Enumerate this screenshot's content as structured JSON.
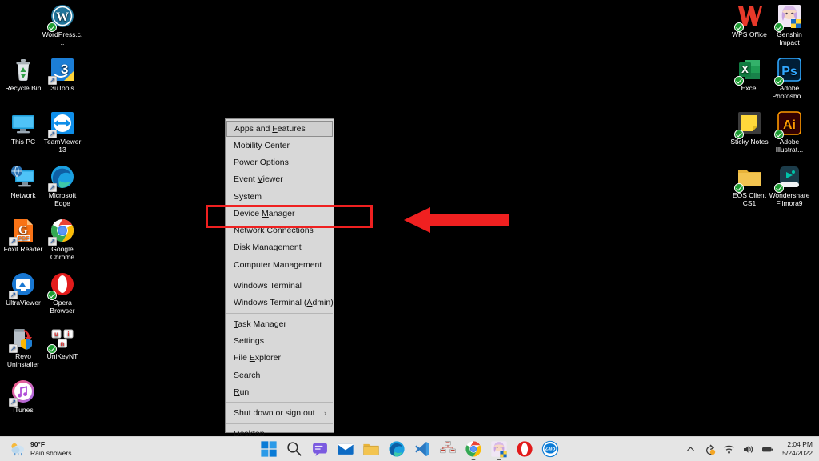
{
  "desktop": {
    "background_color": "#000000",
    "icons_left": [
      {
        "label": "WordPress.c...",
        "icon": "wordpress-icon",
        "col": 1,
        "row": 0,
        "badge": "check"
      },
      {
        "label": "Recycle Bin",
        "icon": "recycle-bin-icon",
        "col": 0,
        "row": 1,
        "badge": "none"
      },
      {
        "label": "3uTools",
        "icon": "3utools-icon",
        "col": 1,
        "row": 1,
        "badge": "shortcut"
      },
      {
        "label": "This PC",
        "icon": "this-pc-icon",
        "col": 0,
        "row": 2,
        "badge": "none"
      },
      {
        "label": "TeamViewer 13",
        "icon": "teamviewer-icon",
        "col": 1,
        "row": 2,
        "badge": "shortcut"
      },
      {
        "label": "Network",
        "icon": "network-icon",
        "col": 0,
        "row": 3,
        "badge": "none"
      },
      {
        "label": "Microsoft Edge",
        "icon": "edge-icon",
        "col": 1,
        "row": 3,
        "badge": "shortcut"
      },
      {
        "label": "Foxit Reader",
        "icon": "foxit-reader-icon",
        "col": 0,
        "row": 4,
        "badge": "shortcut"
      },
      {
        "label": "Google Chrome",
        "icon": "chrome-icon",
        "col": 1,
        "row": 4,
        "badge": "shortcut"
      },
      {
        "label": "UltraViewer",
        "icon": "ultraviewer-icon",
        "col": 0,
        "row": 5,
        "badge": "shortcut"
      },
      {
        "label": "Opera Browser",
        "icon": "opera-icon",
        "col": 1,
        "row": 5,
        "badge": "check"
      },
      {
        "label": "Revo Uninstaller",
        "icon": "revo-uninstaller-icon",
        "col": 0,
        "row": 6,
        "badge": "shortcut"
      },
      {
        "label": "UniKeyNT",
        "icon": "unikey-icon",
        "col": 1,
        "row": 6,
        "badge": "check"
      },
      {
        "label": "iTunes",
        "icon": "itunes-icon",
        "col": 0,
        "row": 7,
        "badge": "shortcut"
      }
    ],
    "icons_right": [
      {
        "label": "WPS Office",
        "icon": "wps-office-icon",
        "col": 0,
        "row": 0,
        "badge": "check"
      },
      {
        "label": "Genshin Impact",
        "icon": "genshin-impact-icon",
        "col": 1,
        "row": 0,
        "badge": "check"
      },
      {
        "label": "Excel",
        "icon": "excel-icon",
        "col": 0,
        "row": 1,
        "badge": "check"
      },
      {
        "label": "Adobe Photosho...",
        "icon": "photoshop-icon",
        "col": 1,
        "row": 1,
        "badge": "check"
      },
      {
        "label": "Sticky Notes",
        "icon": "sticky-notes-icon",
        "col": 0,
        "row": 2,
        "badge": "check"
      },
      {
        "label": "Adobe Illustrat...",
        "icon": "illustrator-icon",
        "col": 1,
        "row": 2,
        "badge": "check"
      },
      {
        "label": "EOS Client CS1",
        "icon": "folder-icon",
        "col": 0,
        "row": 3,
        "badge": "check"
      },
      {
        "label": "Wondershare Filmora9",
        "icon": "filmora-icon",
        "col": 1,
        "row": 3,
        "badge": "check"
      }
    ]
  },
  "context_menu": {
    "name": "win-x-power-user-menu",
    "items": [
      {
        "label": "Apps and Features",
        "accel": "F",
        "highlighted": true,
        "submenu": false,
        "separator_after": false
      },
      {
        "label": "Mobility Center",
        "accel": "B",
        "highlighted": false,
        "submenu": false,
        "separator_after": false
      },
      {
        "label": "Power Options",
        "accel": "O",
        "highlighted": false,
        "submenu": false,
        "separator_after": false
      },
      {
        "label": "Event Viewer",
        "accel": "V",
        "highlighted": false,
        "submenu": false,
        "separator_after": false
      },
      {
        "label": "System",
        "accel": "Y",
        "highlighted": false,
        "submenu": false,
        "separator_after": false
      },
      {
        "label": "Device Manager",
        "accel": "M",
        "highlighted": false,
        "submenu": false,
        "separator_after": false
      },
      {
        "label": "Network Connections",
        "accel": "W",
        "highlighted": false,
        "submenu": false,
        "separator_after": false
      },
      {
        "label": "Disk Management",
        "accel": "K",
        "highlighted": false,
        "submenu": false,
        "separator_after": false
      },
      {
        "label": "Computer Management",
        "accel": "G",
        "highlighted": false,
        "submenu": false,
        "separator_after": true
      },
      {
        "label": "Windows Terminal",
        "accel": "I",
        "highlighted": false,
        "submenu": false,
        "separator_after": false
      },
      {
        "label": "Windows Terminal (Admin)",
        "accel": "A",
        "highlighted": false,
        "submenu": false,
        "separator_after": true
      },
      {
        "label": "Task Manager",
        "accel": "T",
        "highlighted": false,
        "submenu": false,
        "separator_after": false
      },
      {
        "label": "Settings",
        "accel": "N",
        "highlighted": false,
        "submenu": false,
        "separator_after": false
      },
      {
        "label": "File Explorer",
        "accel": "E",
        "highlighted": false,
        "submenu": false,
        "separator_after": false
      },
      {
        "label": "Search",
        "accel": "S",
        "highlighted": false,
        "submenu": false,
        "separator_after": false
      },
      {
        "label": "Run",
        "accel": "R",
        "highlighted": false,
        "submenu": false,
        "separator_after": true
      },
      {
        "label": "Shut down or sign out",
        "accel": "U",
        "highlighted": false,
        "submenu": true,
        "separator_after": true
      },
      {
        "label": "Desktop",
        "accel": "D",
        "highlighted": false,
        "submenu": false,
        "separator_after": false
      }
    ]
  },
  "annotation": {
    "color": "#ef2020",
    "highlight_target": "Device Manager",
    "arrow_direction": "left"
  },
  "taskbar": {
    "weather": {
      "temperature": "90°F",
      "condition": "Rain showers",
      "icon": "sun-behind-rain-cloud-icon"
    },
    "buttons": [
      {
        "name": "start-button",
        "icon": "windows-logo-icon",
        "running": false
      },
      {
        "name": "search-button",
        "icon": "search-icon",
        "running": false
      },
      {
        "name": "chat-button",
        "icon": "chat-icon",
        "running": false
      },
      {
        "name": "mail-button",
        "icon": "mail-icon",
        "running": false
      },
      {
        "name": "file-explorer-button",
        "icon": "folder-icon",
        "running": false
      },
      {
        "name": "edge-button",
        "icon": "edge-icon",
        "running": false
      },
      {
        "name": "vscode-button",
        "icon": "vscode-icon",
        "running": false
      },
      {
        "name": "network-tool-button",
        "icon": "network-map-icon",
        "running": false
      },
      {
        "name": "chrome-button",
        "icon": "chrome-icon",
        "running": true
      },
      {
        "name": "genshin-impact-button",
        "icon": "genshin-impact-icon",
        "running": true
      },
      {
        "name": "opera-button",
        "icon": "opera-icon",
        "running": false
      },
      {
        "name": "zalo-button",
        "icon": "zalo-icon",
        "running": false
      }
    ],
    "tray": [
      {
        "name": "show-hidden-icons",
        "icon": "chevron-up-icon"
      },
      {
        "name": "onedrive-sync",
        "icon": "onedrive-sync-icon"
      },
      {
        "name": "network",
        "icon": "wifi-icon"
      },
      {
        "name": "volume",
        "icon": "speaker-icon"
      },
      {
        "name": "battery",
        "icon": "battery-icon"
      }
    ],
    "clock": {
      "time": "2:04 PM",
      "date": "5/24/2022"
    }
  }
}
